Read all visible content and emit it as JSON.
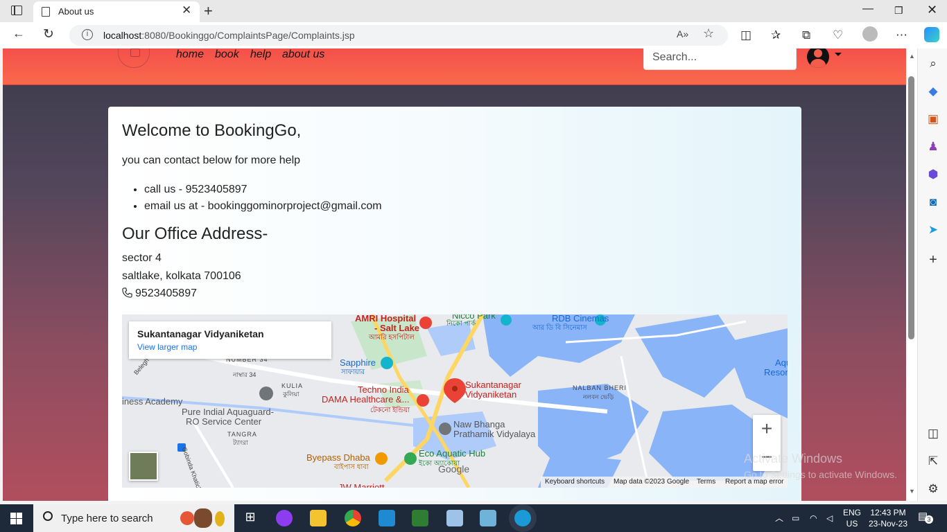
{
  "browser": {
    "tab_title": "About us",
    "url_host": "localhost",
    "url_rest": ":8080/Bookinggo/ComplaintsPage/Complaints.jsp"
  },
  "site": {
    "nav": [
      "home",
      "book",
      "help",
      "about us"
    ],
    "search_placeholder": "Search..."
  },
  "content": {
    "welcome": "Welcome to BookingGo,",
    "contact_intro": "you can contact below for more help",
    "contacts": [
      "call us - 9523405897",
      "email us at - bookinggominorproject@gmail.com"
    ],
    "office_heading": "Our Office Address-",
    "address_line1": "sector 4",
    "address_line2": "saltlake, kolkata 700106",
    "phone": "9523405897"
  },
  "map": {
    "place_name": "Sukantanagar Vidyaniketan",
    "view_larger": "View larger map",
    "labels": {
      "amri": "AMRI Hospital",
      "saltlake": "- Salt Lake",
      "amri_bn": "আমরি হসপিটাল",
      "nicco": "Nicco Park",
      "nicco_bn": "নিকো পার্ক",
      "rdb": "RDB Cinemas",
      "rdb_bn": "আর ডি বি সিনেমাস",
      "sapphire": "Sapphire",
      "sapphire_bn": "সাফায়ার",
      "number34": "NUMBER 34",
      "number34_bn": "নাম্বার 34",
      "kulia": "KULIA",
      "kulia_bn": "কুলিয়া",
      "techno": "Techno India",
      "dama": "DAMA Healthcare &...",
      "dama_bn": "টেকনো ইন্ডিয়া",
      "sukanta1": "Sukantanagar",
      "sukanta2": "Vidyaniketan",
      "nalban": "NALBAN BHERI",
      "nalban_bn": "নলবন ভেড়ি",
      "academy": "iness Academy",
      "pure1": "Pure Indial Aquaguard-",
      "pure2": "RO Service Center",
      "tangra": "TANGRA",
      "tangra_bn": "ট্যাংরা",
      "naw1": "Naw Bhanga",
      "naw2": "Prathamik Vidyalaya",
      "byepass": "Byepass Dhaba",
      "byepass_bn": "বাইপাস ধাবা",
      "eco": "Eco Aquatic Hub",
      "eco_bn": "ইকো অ্যাকোয়া",
      "jw": "JW Marriott",
      "aqua": "Aqu",
      "resor": "Resor",
      "belegh": "Belegh",
      "gobinda": "Gobinda Khatick R",
      "google": "Google"
    },
    "zoom_in": "+",
    "zoom_out": "−",
    "attribution": [
      "Keyboard shortcuts",
      "Map data ©2023 Google",
      "Terms",
      "Report a map error"
    ]
  },
  "watermark": {
    "line1": "Activate Windows",
    "line2": "Go to Settings to activate Windows."
  },
  "taskbar": {
    "search_text": "Type here to search",
    "lang1": "ENG",
    "lang2": "US",
    "time": "12:43 PM",
    "date": "23-Nov-23",
    "notif_count": "3"
  }
}
